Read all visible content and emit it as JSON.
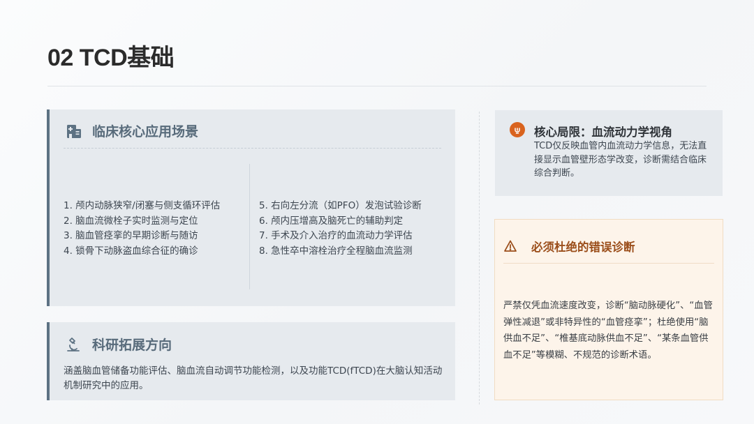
{
  "page": {
    "title": "02 TCD基础"
  },
  "clinical": {
    "heading": "临床核心应用场景",
    "left_items": [
      "1. 颅内动脉狭窄/闭塞与侧支循环评估",
      "2. 脑血流微栓子实时监测与定位",
      "3. 脑血管痉挛的早期诊断与随访",
      "4. 锁骨下动脉盗血综合征的确诊"
    ],
    "right_items": [
      "5. 右向左分流（如PFO）发泡试验诊断",
      "6. 颅内压增高及脑死亡的辅助判定",
      "7. 手术及介入治疗的血流动力学评估",
      "8. 急性卒中溶栓治疗全程脑血流监测"
    ]
  },
  "research": {
    "heading": "科研拓展方向",
    "text": "涵盖脑血管储备功能评估、脑血流自动调节功能检测，以及功能TCD(fTCD)在大脑认知活动机制研究中的应用。"
  },
  "limitation": {
    "title": "核心局限：血流动力学视角",
    "text": "TCD仅反映血管内血流动力学信息，无法直接显示血管壁形态学改变，诊断需结合临床综合判断。"
  },
  "warning": {
    "title": "必须杜绝的错误诊断",
    "text": "严禁仅凭血流速度改变，诊断“脑动脉硬化”、“血管弹性减退”或非特异性的“血管痉挛”；杜绝使用“脑供血不足”、“椎基底动脉供血不足”、“某条血管供血不足”等模糊、不规范的诊断术语。"
  },
  "icons": {
    "clinical": "hospital-icon",
    "research": "microscope-icon",
    "limitation": "lightbulb-icon",
    "warning": "warning-triangle-icon"
  },
  "colors": {
    "accent": "#5d7283",
    "warning": "#9b4e1b",
    "limit_icon": "#d9631e"
  }
}
